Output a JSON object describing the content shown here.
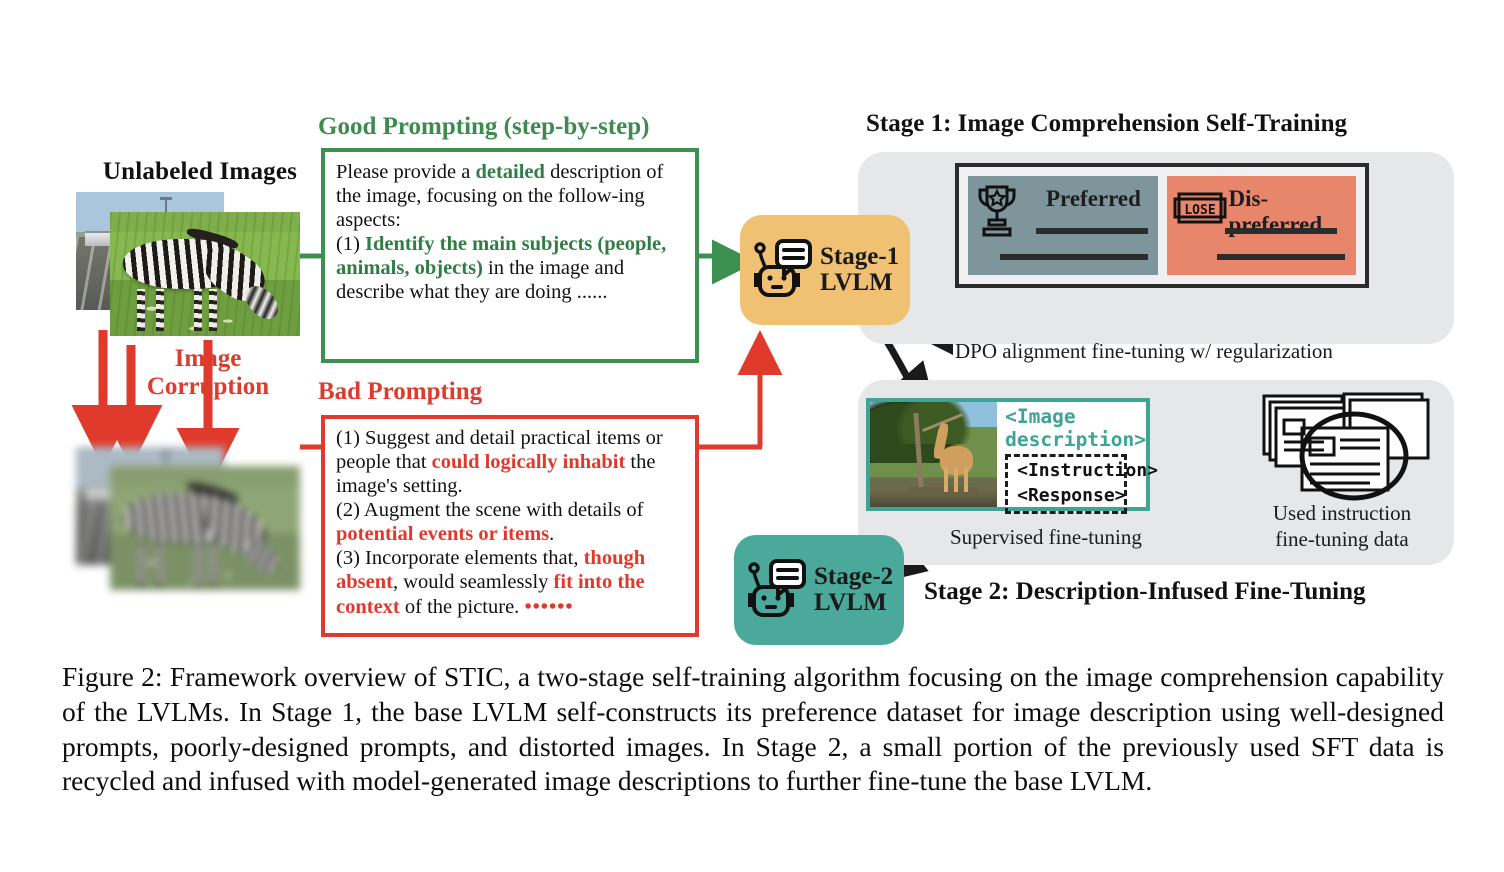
{
  "figure": {
    "headings": {
      "unlabeled_images": "Unlabeled Images",
      "image_corruption_line1": "Image",
      "image_corruption_line2": "Corruption",
      "good_prompting": "Good Prompting (step-by-step)",
      "bad_prompting": "Bad Prompting",
      "stage1": "Stage 1: Image Comprehension Self-Training",
      "stage2": "Stage 2: Description-Infused Fine-Tuning"
    },
    "good_prompt": {
      "t1": "Please provide a ",
      "b1": "detailed",
      "t2": " description of the image, focusing on the follow-ing aspects:",
      "t3": "(1) ",
      "b2": "Identify the main subjects (people, animals, objects)",
      "t4": " in the image and describe what they are doing ......"
    },
    "bad_prompt": {
      "t1": "(1) Suggest and detail practical items or people that ",
      "b1": "could logically inhabit",
      "t2": " the image's setting.",
      "t3": "(2) Augment the scene with details of ",
      "b2": "potential events or items",
      "t4": ".",
      "t5": "(3) Incorporate elements that, ",
      "b3": "though absent",
      "t6": ", would seamlessly ",
      "b4": "fit into the context",
      "t7": " of the picture.  ",
      "dots": "••••••"
    },
    "chips": {
      "stage1_line1": "Stage-1",
      "stage1_line2": "LVLM",
      "stage2_line1": "Stage-2",
      "stage2_line2": "LVLM"
    },
    "preference": {
      "preferred_label": "Preferred",
      "dispreferred_label": "Dis-preferred",
      "lose_badge": "LOSE"
    },
    "panel_captions": {
      "dpo": "DPO alignment fine-tuning w/ regularization",
      "sft": "Supervised fine-tuning",
      "data_line1": "Used instruction",
      "data_line2": "fine-tuning data"
    },
    "stage2_box": {
      "image_description": "<Image description>",
      "instruction": "<Instruction>",
      "response": "<Response>"
    },
    "colors": {
      "good_green": "#3d8b4f",
      "bad_red": "#dc3c2c",
      "stage1_orange": "#f0c172",
      "stage2_teal": "#4aa99a",
      "preferred_slate": "#7d959b",
      "dispreferred_salmon": "#e8866b",
      "panel_gray": "#e6e7e9",
      "arrow_black": "#1a1a1a"
    },
    "caption": "Figure 2: Framework overview of STIC, a two-stage self-training algorithm focusing on the image comprehension capability of the LVLMs. In Stage 1, the base LVLM self-constructs its preference dataset for image description using well-designed prompts, poorly-designed prompts, and distorted images. In Stage 2, a small portion of the previously used SFT data is recycled and infused with model-generated image descriptions to further fine-tune the base LVLM."
  }
}
